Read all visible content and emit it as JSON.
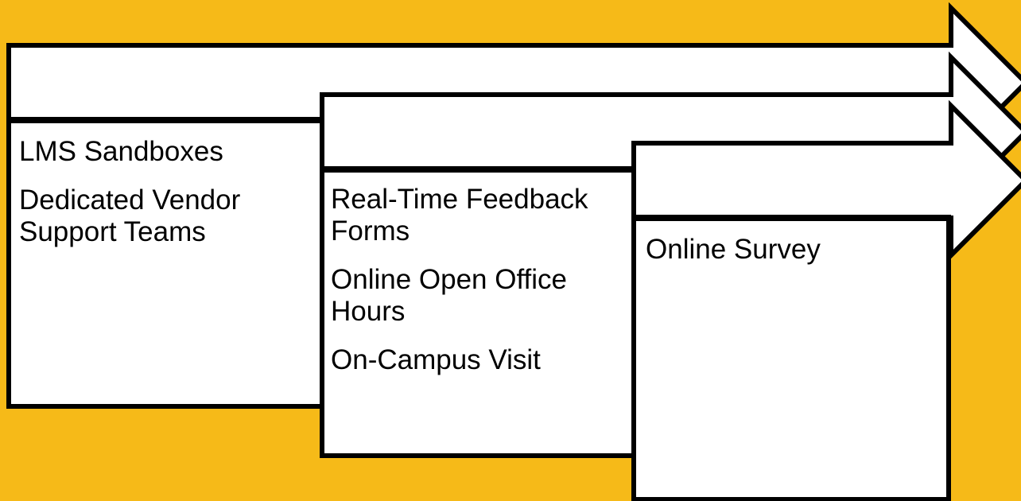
{
  "colors": {
    "background": "#F6BA18",
    "shape_fill": "#FFFFFF",
    "outline": "#000000"
  },
  "stages": [
    {
      "items": [
        "LMS Sandboxes",
        "Dedicated Vendor Support Teams"
      ]
    },
    {
      "items": [
        "Real-Time Feedback Forms",
        "Online Open Office Hours",
        "On-Campus Visit"
      ]
    },
    {
      "items": [
        "Online Survey"
      ]
    }
  ]
}
